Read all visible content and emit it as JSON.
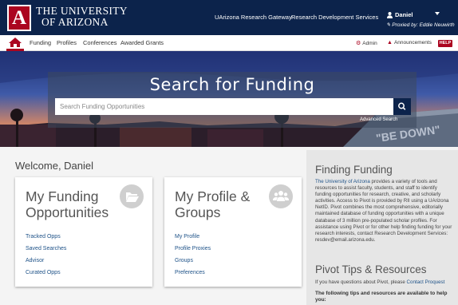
{
  "header": {
    "university_line1": "THE UNIVERSITY",
    "university_line2": "OF ARIZONA",
    "logo_letter": "A",
    "links": [
      "UArizona Research Gateway",
      "Research Development Services"
    ],
    "user_name": "Daniel",
    "proxied_by": "Proxied by: Eddie Neuwirth"
  },
  "nav": {
    "items": [
      "Funding",
      "Profiles",
      "Conferences",
      "Awarded Grants"
    ],
    "admin": "Admin",
    "announcements": "Announcements",
    "help": "HELP"
  },
  "hero": {
    "title": "Search for Funding",
    "search_placeholder": "Search Funding Opportunities",
    "advanced_search": "Advanced Search",
    "building_text": "\"BE DOWN\""
  },
  "main": {
    "welcome": "Welcome, Daniel",
    "funding_card": {
      "title": "My Funding Opportunities",
      "links": [
        "Tracked Opps",
        "Saved Searches",
        "Advisor",
        "Curated Opps"
      ]
    },
    "profile_card": {
      "title": "My Profile & Groups",
      "links": [
        "My Profile",
        "Profile Proxies",
        "Groups",
        "Preferences"
      ]
    }
  },
  "side": {
    "finding_heading": "Finding Funding",
    "finding_link": "The University of Arizona",
    "finding_text": " provides a variety of tools and resources to assist faculty, students, and staff to identify funding opportunities for research, creative, and scholarly activities. Access to Pivot is provided by RII using a UArizona NetID. Pivot combines the most comprehensive, editorially maintained database of funding opportunities with a unique database of 3 million pre-populated scholar profiles. For assistance using Pivot or for other help finding funding for your research interests, contact Research Development Services: resdev@email.arizona.edu.",
    "tips_heading": "Pivot Tips & Resources",
    "tips_text": "If you have questions about Pivot, please ",
    "tips_link": "Contact Proquest",
    "tips_bold": "The following tips and resources are available to help you:"
  },
  "colors": {
    "navy": "#0c234b",
    "red": "#ab0520",
    "link": "#1e5288"
  }
}
